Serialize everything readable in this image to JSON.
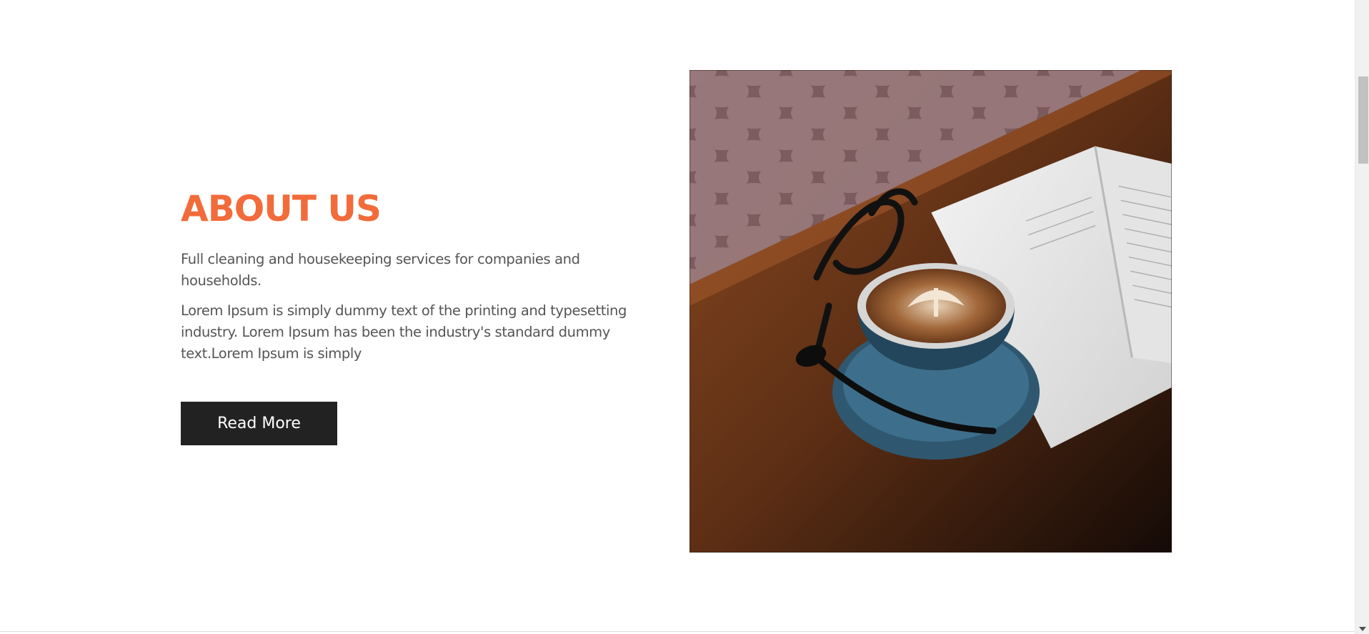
{
  "about": {
    "title": "ABOUT US",
    "subtitle": "Full cleaning and housekeeping services for companies and households.",
    "body": "Lorem Ipsum is simply dummy text of the printing and typesetting industry. Lorem Ipsum has been the industry's standard dummy text.Lorem Ipsum is simply",
    "button_label": "Read More"
  },
  "colors": {
    "accent": "#f26b3a",
    "button_bg": "#222222",
    "body_text": "#555555"
  },
  "image": {
    "subject": "coffee-cup-book-glasses-photo"
  }
}
